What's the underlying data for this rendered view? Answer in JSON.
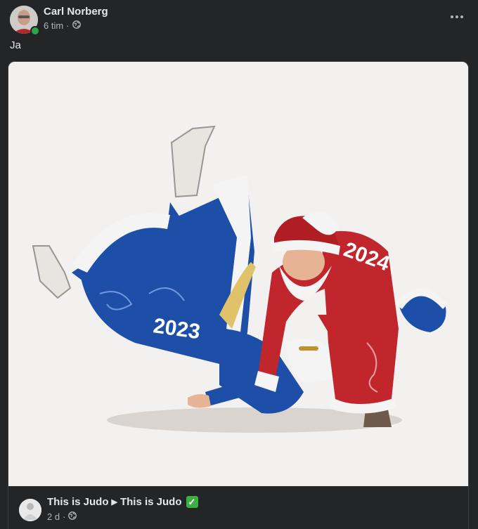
{
  "post": {
    "author": "Carl Norberg",
    "time": "6 tim",
    "separator": "·",
    "visibility_icon": "globe-icon",
    "text": "Ja",
    "more_icon": "more-options-icon"
  },
  "shared": {
    "page_name": "This is Judo",
    "arrow_icon": "triangle-right-icon",
    "target_name": "This is Judo",
    "verified_icon": "green-check-icon",
    "time": "2 d",
    "separator": "·",
    "visibility_icon": "globe-icon"
  },
  "illustration": {
    "label_left": "2023",
    "label_right": "2024",
    "colors": {
      "blue": "#1e4fa8",
      "red": "#c0262b",
      "fur": "#f4f4f4",
      "background": "#f2f1ef"
    }
  },
  "colors": {
    "background": "#242526",
    "primary_text": "#e4e6eb",
    "secondary_text": "#b0b3b8",
    "online": "#31a24c"
  }
}
